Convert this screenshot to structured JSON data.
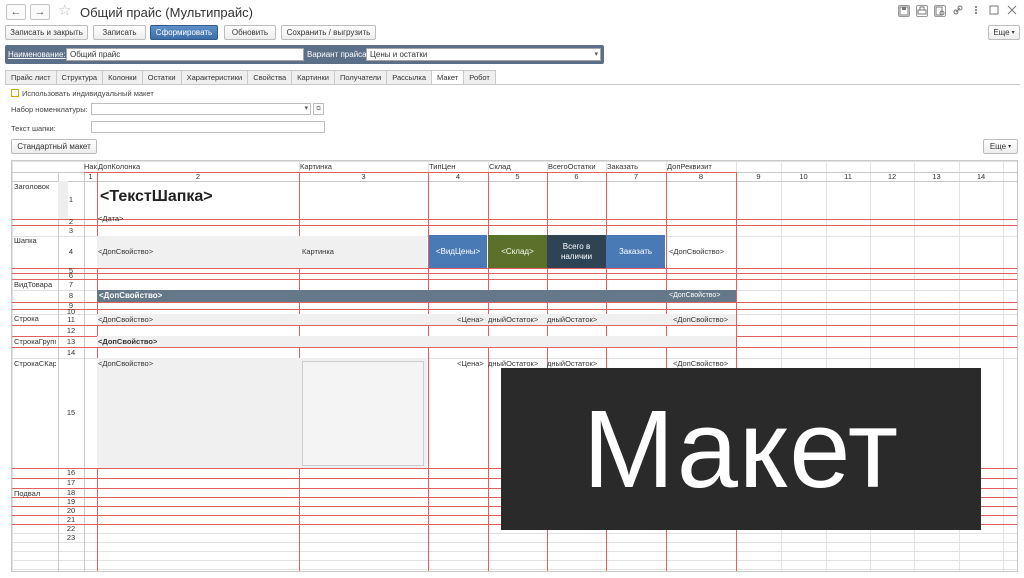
{
  "window": {
    "title": "Общий прайс (Мультипрайс)",
    "back_glyph": "←",
    "forward_glyph": "→",
    "star_glyph": "☆"
  },
  "toolbar": {
    "save_close": "Записать и закрыть",
    "save": "Записать",
    "generate": "Сформировать",
    "refresh": "Обновить",
    "save_export": "Сохранить / выгрузить",
    "more": "Еще"
  },
  "header": {
    "name_label": "Наименование:",
    "name_value": "Общий прайс",
    "variant_label": "Вариант прайса:",
    "variant_value": "Цены и остатки"
  },
  "tabs": [
    {
      "label": "Прайс лист"
    },
    {
      "label": "Структура"
    },
    {
      "label": "Колонки"
    },
    {
      "label": "Остатки"
    },
    {
      "label": "Характеристики"
    },
    {
      "label": "Свойства"
    },
    {
      "label": "Картинки"
    },
    {
      "label": "Получатели"
    },
    {
      "label": "Рассылка"
    },
    {
      "label": "Макет",
      "active": true
    },
    {
      "label": "Робот"
    }
  ],
  "form": {
    "use_layout_label": "Использовать индивидуальный макет",
    "nomenclature_label": "Набор номенклатуры:",
    "header_text_label": "Текст шапки:",
    "standard_layout_button": "Стандартный макет",
    "more": "Еще"
  },
  "sheet": {
    "column_headers": [
      "Нак",
      "ДопКолонка",
      "Картинка",
      "ТипЦен",
      "Склад",
      "ВсегоОстатки",
      "Заказать",
      "ДопРеквизит"
    ],
    "column_numbers": [
      "1",
      "2",
      "3",
      "4",
      "5",
      "6",
      "7",
      "8",
      "9",
      "10",
      "11",
      "12",
      "13",
      "14"
    ],
    "row_numbers": [
      "1",
      "2",
      "3",
      "4",
      "5",
      "6",
      "7",
      "8",
      "9",
      "10",
      "11",
      "12",
      "13",
      "14",
      "15",
      "16",
      "17",
      "18",
      "19",
      "20",
      "21",
      "22",
      "23"
    ],
    "sections": {
      "title": "Заголовок",
      "cap": "Шапка",
      "item_type": "ВидТовара",
      "row": "Строка",
      "row_group": "СтрокаГрупп",
      "row_with_picture": "СтрокаСКар",
      "footer": "Подвал"
    },
    "cells": {
      "header_text": "<ТекстШапка>",
      "date": "<Дата>",
      "extra_prop": "<ДопСвойство>",
      "picture": "Картинка",
      "price_type": "<ВидЦены>",
      "warehouse": "<Склад>",
      "in_stock": "Всего в наличии",
      "order": "Заказать",
      "price": "<Цена>",
      "balance": "дныйОстаток>"
    }
  },
  "overlay": {
    "text": "Макет"
  }
}
